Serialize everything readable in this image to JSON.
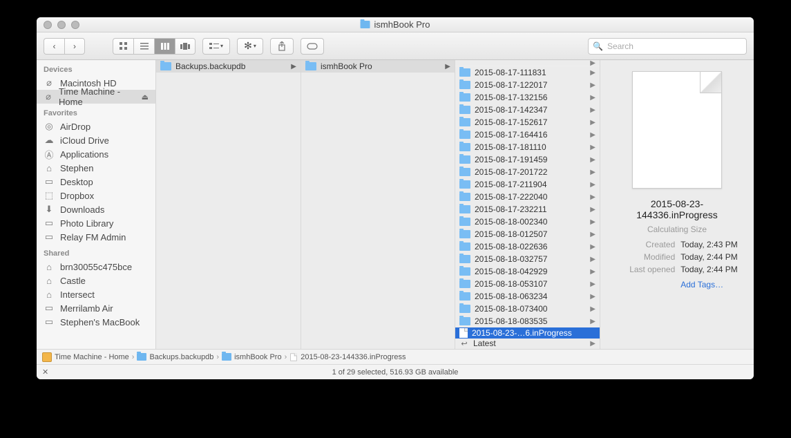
{
  "window": {
    "title": "ismhBook Pro"
  },
  "search": {
    "placeholder": "Search"
  },
  "sidebar": {
    "groups": [
      {
        "label": "Devices",
        "items": [
          {
            "name": "Macintosh HD",
            "icon": "hdd-icon"
          },
          {
            "name": "Time Machine - Home",
            "icon": "hdd-icon",
            "selected": true,
            "ejectable": true
          }
        ]
      },
      {
        "label": "Favorites",
        "items": [
          {
            "name": "AirDrop",
            "icon": "airdrop-icon"
          },
          {
            "name": "iCloud Drive",
            "icon": "cloud-icon"
          },
          {
            "name": "Applications",
            "icon": "apps-icon"
          },
          {
            "name": "Stephen",
            "icon": "home-icon"
          },
          {
            "name": "Desktop",
            "icon": "desktop-icon"
          },
          {
            "name": "Dropbox",
            "icon": "dropbox-icon"
          },
          {
            "name": "Downloads",
            "icon": "downloads-icon"
          },
          {
            "name": "Photo Library",
            "icon": "folder-icon"
          },
          {
            "name": "Relay FM Admin",
            "icon": "folder-icon"
          }
        ]
      },
      {
        "label": "Shared",
        "items": [
          {
            "name": "brn30055c475bce",
            "icon": "shared-icon"
          },
          {
            "name": "Castle",
            "icon": "shared-icon"
          },
          {
            "name": "Intersect",
            "icon": "shared-icon"
          },
          {
            "name": "Merrilamb Air",
            "icon": "laptop-icon"
          },
          {
            "name": "Stephen's MacBook",
            "icon": "laptop-icon"
          }
        ]
      }
    ]
  },
  "col1_item": "Backups.backupdb",
  "col2_item": "ismhBook Pro",
  "col3_items": [
    "2015-08-17-111831",
    "2015-08-17-122017",
    "2015-08-17-132156",
    "2015-08-17-142347",
    "2015-08-17-152617",
    "2015-08-17-164416",
    "2015-08-17-181110",
    "2015-08-17-191459",
    "2015-08-17-201722",
    "2015-08-17-211904",
    "2015-08-17-222040",
    "2015-08-17-232211",
    "2015-08-18-002340",
    "2015-08-18-012507",
    "2015-08-18-022636",
    "2015-08-18-032757",
    "2015-08-18-042929",
    "2015-08-18-053107",
    "2015-08-18-063234",
    "2015-08-18-073400",
    "2015-08-18-083535"
  ],
  "col3_selected_display": "2015-08-23-…6.inProgress",
  "col3_latest": "Latest",
  "preview": {
    "name": "2015-08-23-144336.inProgress",
    "calc": "Calculating Size",
    "created_k": "Created",
    "created_v": "Today, 2:43 PM",
    "modified_k": "Modified",
    "modified_v": "Today, 2:44 PM",
    "lastopened_k": "Last opened",
    "lastopened_v": "Today, 2:44 PM",
    "addtags": "Add Tags…"
  },
  "path": {
    "p1": "Time Machine - Home",
    "p2": "Backups.backupdb",
    "p3": "ismhBook Pro",
    "p4": "2015-08-23-144336.inProgress"
  },
  "status": "1 of 29 selected, 516.93 GB available"
}
